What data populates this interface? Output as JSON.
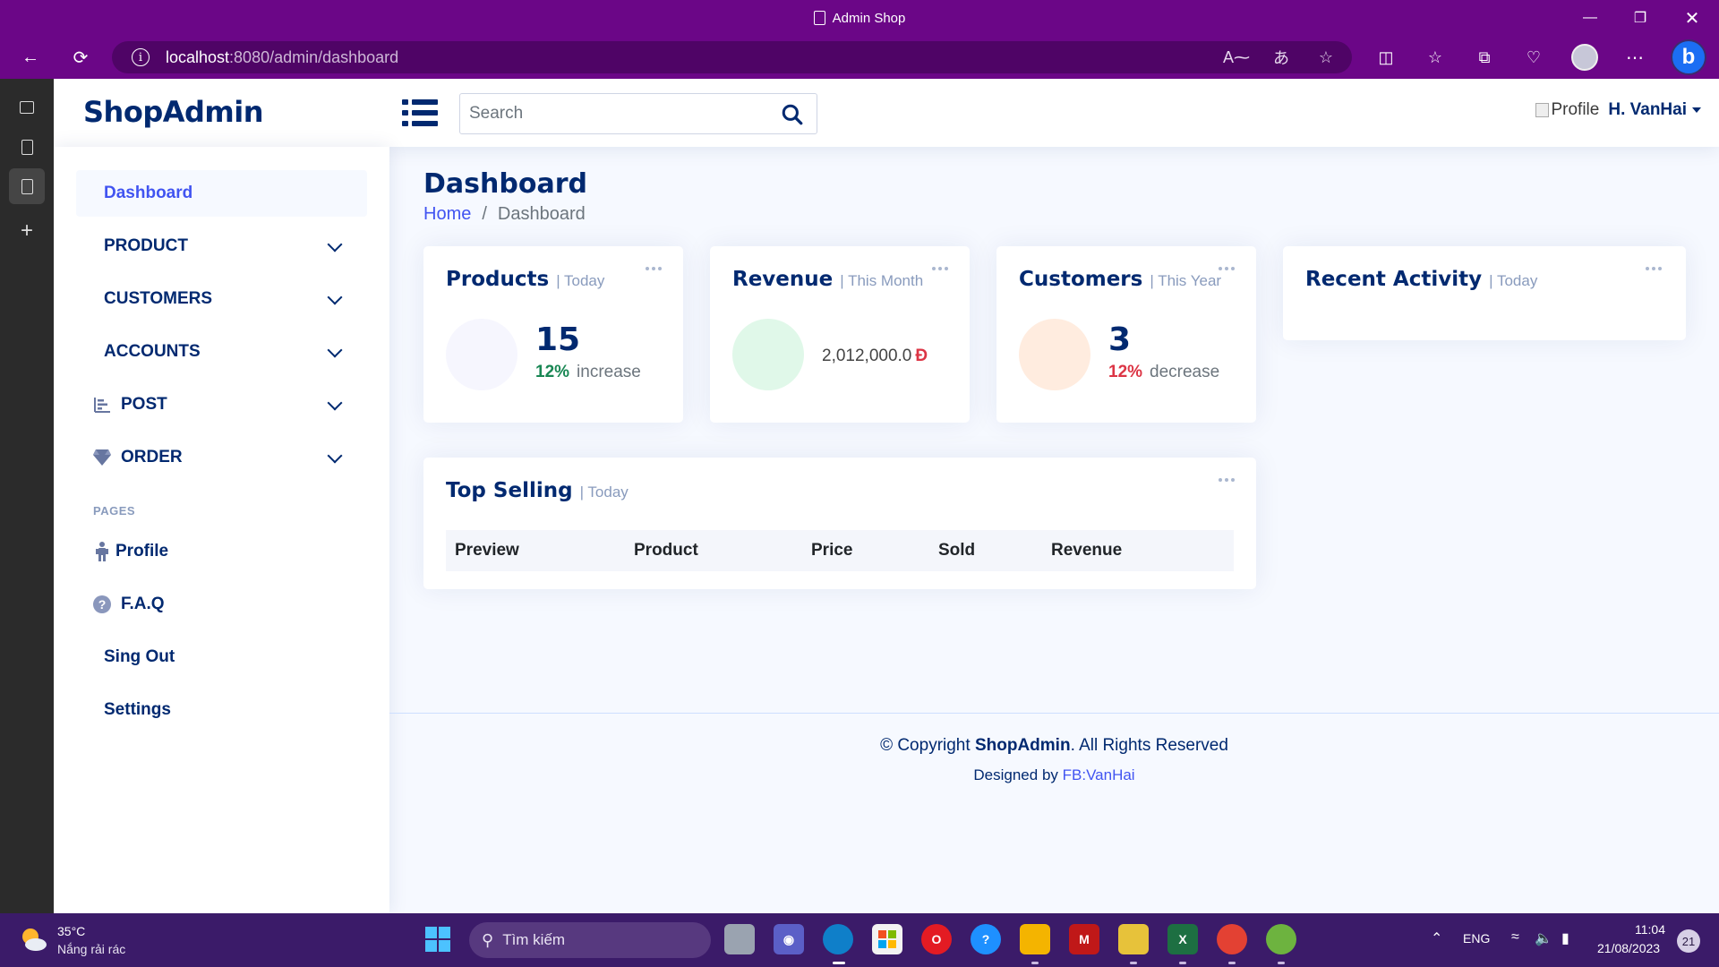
{
  "window": {
    "title": "Admin Shop"
  },
  "browser": {
    "url_host": "localhost",
    "url_path": ":8080/admin/dashboard"
  },
  "header": {
    "logo": "ShopAdmin",
    "search_placeholder": "Search",
    "profile_alt": "Profile",
    "user_name": "H. VanHai"
  },
  "sidebar": {
    "active_item": "Dashboard",
    "items": [
      {
        "label": "PRODUCT"
      },
      {
        "label": "CUSTOMERS"
      },
      {
        "label": "ACCOUNTS"
      },
      {
        "label": "POST"
      },
      {
        "label": "ORDER"
      }
    ],
    "pages_heading": "PAGES",
    "profile": "Profile",
    "faq": "F.A.Q",
    "sign_out": "Sing Out",
    "settings": "Settings"
  },
  "main": {
    "title": "Dashboard",
    "breadcrumb": {
      "home": "Home",
      "separator": "/",
      "current": "Dashboard"
    },
    "cards": {
      "products": {
        "title": "Products",
        "period": "| Today",
        "value": "15",
        "pct": "12%",
        "trend": "increase"
      },
      "revenue": {
        "title": "Revenue",
        "period": "| This Month",
        "value": "2,012,000.0",
        "currency": "Đ"
      },
      "customers": {
        "title": "Customers",
        "period": "| This Year",
        "value": "3",
        "pct": "12%",
        "trend": "decrease"
      },
      "activity": {
        "title": "Recent Activity",
        "period": "| Today"
      }
    },
    "top_selling": {
      "title": "Top Selling",
      "period": "| Today",
      "columns": [
        "Preview",
        "Product",
        "Price",
        "Sold",
        "Revenue"
      ]
    },
    "footer": {
      "copyright_prefix": "© Copyright",
      "brand": "ShopAdmin",
      "copyright_suffix": ". All Rights Reserved",
      "designed_prefix": "Designed by",
      "designed_link": "FB:VanHai"
    }
  },
  "taskbar": {
    "temperature": "35°C",
    "weather": "Nắng rải rác",
    "search": "Tìm kiếm",
    "language": "ENG",
    "time": "11:04",
    "date": "21/08/2023",
    "notifications": "21"
  },
  "colors": {
    "accent": "#4154f1",
    "brand": "#012970",
    "titlebar": "#6b0687",
    "increase": "#198754",
    "decrease": "#dc3545"
  }
}
